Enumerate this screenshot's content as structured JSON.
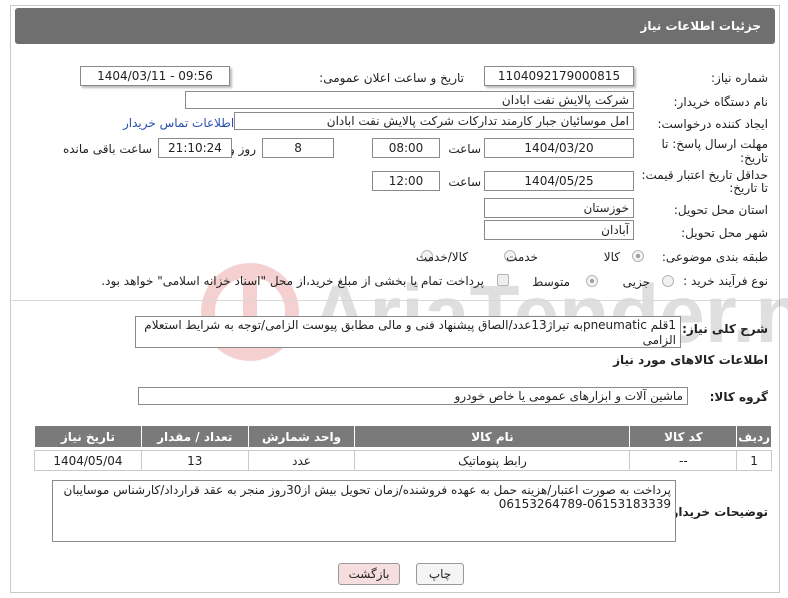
{
  "header": {
    "title": "جزئیات اطلاعات نیاز"
  },
  "form": {
    "need_number_label": "شماره نیاز:",
    "need_number": "1104092179000815",
    "announce_label": "تاریخ و ساعت اعلان عمومی:",
    "announce_value": "1404/03/11 - 09:56",
    "buyer_org_label": "نام دستگاه خریدار:",
    "buyer_org": "شرکت پالایش نفت ابادان",
    "creator_label": "ایجاد کننده درخواست:",
    "creator": "امل موسائیان جبار کارمند تدارکات شرکت پالایش نفت ابادان",
    "contact_link": "اطلاعات تماس خریدار",
    "deadline_label_1": "مهلت ارسال پاسخ: تا",
    "deadline_label_2": "تاریخ:",
    "deadline_date": "1404/03/20",
    "time_word": "ساعت",
    "deadline_time": "08:00",
    "days_value": "8",
    "days_and": "روز و",
    "remaining_time": "21:10:24",
    "remaining_label": "ساعت باقی مانده",
    "validity_label_1": "حداقل تاریخ اعتبار قیمت:",
    "validity_label_2": "تا تاریخ:",
    "validity_date": "1404/05/25",
    "validity_time": "12:00",
    "province_label": "استان محل تحویل:",
    "province": "خوزستان",
    "city_label": "شهر محل تحویل:",
    "city": "آبادان",
    "category_label": "طبقه بندی موضوعی:",
    "category_options": [
      "کالا",
      "خدمت",
      "کالا/خدمت"
    ],
    "process_label": "نوع فرآیند خرید :",
    "process_options": [
      "جزیی",
      "متوسط"
    ],
    "payment_note": "پرداخت تمام یا بخشی از مبلغ خرید،از محل \"اسناد خزانه اسلامی\" خواهد بود.",
    "description_label": "شرح کلی نیاز:",
    "description": "1قلم pneumaticبه تیراژ13عدد/الصاق پیشنهاد فنی و مالی مطابق پیوست الزامی/توجه به شرایط استعلام الزامی"
  },
  "goods": {
    "section_title": "اطلاعات کالاهای مورد نیاز",
    "group_label": "گروه کالا:",
    "group_value": "ماشین آلات و ابزارهای عمومی یا خاص خودرو",
    "columns": [
      "ردیف",
      "کد کالا",
      "نام کالا",
      "واحد شمارش",
      "تعداد / مقدار",
      "تاریخ نیاز"
    ],
    "rows": [
      {
        "row": "1",
        "code": "--",
        "name": "رابط پنوماتیک",
        "unit": "عدد",
        "qty": "13",
        "date": "1404/05/04"
      }
    ]
  },
  "buyer_notes": {
    "label": "توضیحات خریدار:",
    "text": "پرداخت به صورت اعتبار/هزینه حمل به عهده فروشنده/زمان تحویل بیش از30روز منجر به عقد قرارداد/کارشناس موسایبان 06153183339-06153264789"
  },
  "buttons": {
    "print": "چاپ",
    "back": "بازگشت"
  },
  "watermark_text": "AriaTender.net",
  "colors": {
    "header_bg": "#6f6f6f",
    "table_header_bg": "#7a7a7a",
    "link": "#2a4fb0",
    "back_button_bg": "#f6dede"
  }
}
